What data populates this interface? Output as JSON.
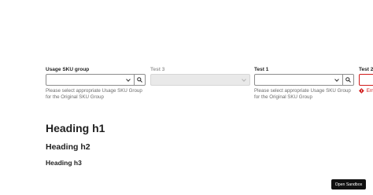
{
  "fields": {
    "usage_sku_group": {
      "label": "Usage SKU group",
      "help": "Please select appropriate Usage SKU Group for the Original SKU Group"
    },
    "test3": {
      "label": "Test 3"
    },
    "test1": {
      "label": "Test 1",
      "help": "Please select appropriate Usage SKU Group for the Original SKU Group"
    },
    "test2": {
      "label": "Test 2",
      "error": "Err"
    }
  },
  "headings": {
    "h1": "Heading h1",
    "h2": "Heading h2",
    "h3": "Heading h3"
  },
  "sandbox_button": {
    "label": "Open Sandbox"
  },
  "colors": {
    "error": "#d01b1b",
    "button_bg": "#111111"
  },
  "icons": {
    "search": "search-icon",
    "chevron": "chevron-down-icon",
    "error": "error-diamond-icon"
  }
}
